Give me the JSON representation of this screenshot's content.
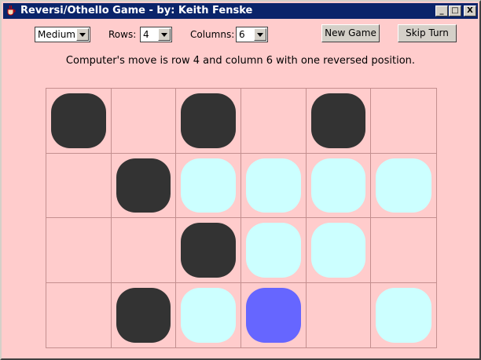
{
  "window": {
    "title": "Reversi/Othello Game - by: Keith Fenske",
    "min_label": "_",
    "max_label": "□",
    "close_label": "X"
  },
  "controls": {
    "difficulty": "Medium",
    "rows_label": "Rows:",
    "rows_value": "4",
    "columns_label": "Columns:",
    "columns_value": "6",
    "new_game_label": "New Game",
    "skip_turn_label": "Skip Turn"
  },
  "status": "Computer's move is row 4 and column 6 with one reversed position.",
  "board": {
    "rows": 4,
    "columns": 6,
    "cells": [
      [
        "black",
        "",
        "black",
        "",
        "black",
        ""
      ],
      [
        "",
        "black",
        "white",
        "white",
        "white",
        "white"
      ],
      [
        "",
        "",
        "black",
        "white",
        "white",
        ""
      ],
      [
        "",
        "black",
        "white",
        "last",
        "",
        "white"
      ]
    ],
    "colors": {
      "background": "#ffcccc",
      "grid": "#c48f8f",
      "black": "#333333",
      "white": "#ccffff",
      "last_move": "#6666ff"
    }
  }
}
